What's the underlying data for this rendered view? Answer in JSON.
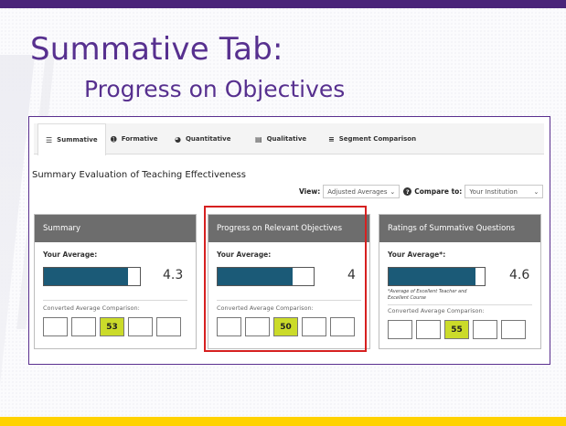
{
  "slide": {
    "title": "Summative Tab:",
    "subtitle": "Progress on Objectives",
    "colors": {
      "accent": "#57308f",
      "bottom_bar": "#ffd200",
      "bar_fill": "#1b5a77",
      "highlight": "#cbdb2a",
      "outline": "#d62020"
    }
  },
  "tabs": [
    {
      "label": "Summative",
      "icon": "bar-chart-icon",
      "active": true
    },
    {
      "label": "Formative",
      "icon": "info-icon",
      "active": false
    },
    {
      "label": "Quantitative",
      "icon": "pie-chart-icon",
      "active": false
    },
    {
      "label": "Qualitative",
      "icon": "document-icon",
      "active": false
    },
    {
      "label": "Segment Comparison",
      "icon": "list-icon",
      "active": false
    }
  ],
  "evaluation_title": "Summary Evaluation of Teaching Effectiveness",
  "controls": {
    "view_label": "View:",
    "view_value": "Adjusted Averages",
    "compare_label": "Compare to:",
    "compare_value": "Your Institution"
  },
  "panels": [
    {
      "header": "Summary",
      "avg_label": "Your Average:",
      "value": "4.3",
      "fill": 0.88,
      "footnote": "",
      "conv_label": "Converted Average Comparison:",
      "boxes": [
        "",
        "",
        "53",
        "",
        ""
      ],
      "highlight_index": 2
    },
    {
      "header": "Progress on Relevant Objectives",
      "avg_label": "Your Average:",
      "value": "4",
      "fill": 0.78,
      "footnote": "",
      "conv_label": "Converted Average Comparison:",
      "boxes": [
        "",
        "",
        "50",
        "",
        ""
      ],
      "highlight_index": 2
    },
    {
      "header": "Ratings of Summative Questions",
      "avg_label": "Your Average*:",
      "value": "4.6",
      "fill": 0.9,
      "footnote": "*Average of Excellent Teacher and Excellent Course",
      "conv_label": "Converted Average Comparison:",
      "boxes": [
        "",
        "",
        "55",
        "",
        ""
      ],
      "highlight_index": 2
    }
  ]
}
